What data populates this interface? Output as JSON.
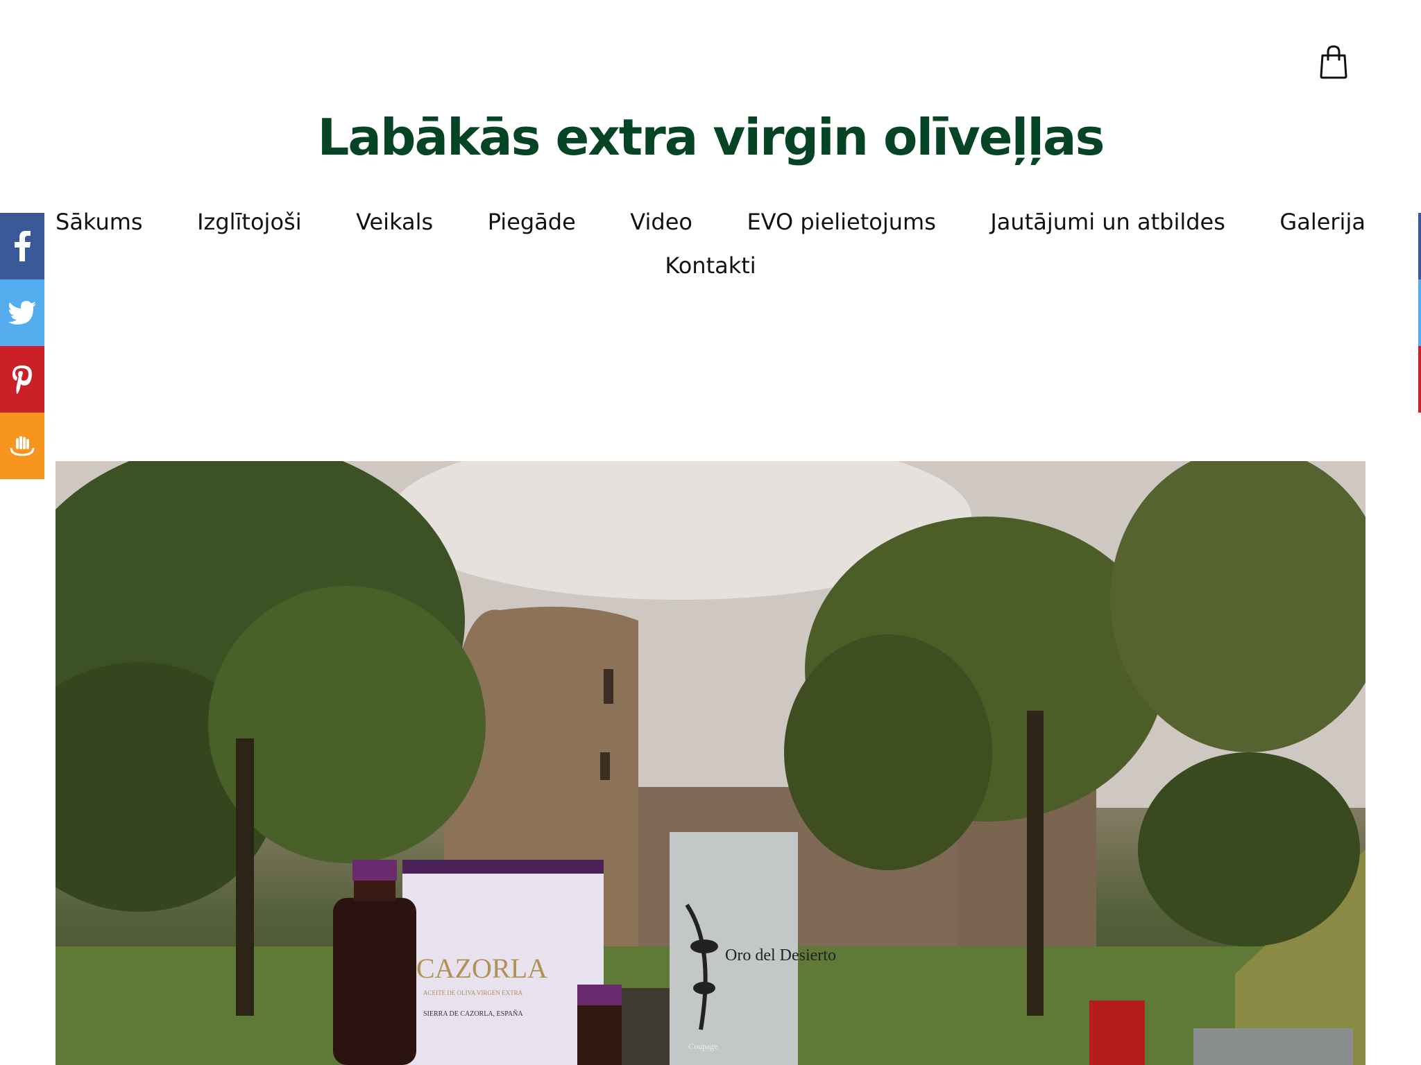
{
  "header": {
    "title": "Labākās extra virgin olīveļļas",
    "cart_icon": "shopping-bag-icon"
  },
  "nav": {
    "items": [
      "Sākums",
      "Izglītojoši",
      "Veikals",
      "Piegāde",
      "Video",
      "EVO pielietojums",
      "Jautājumi un atbildes",
      "Galerija",
      "Kontakti"
    ]
  },
  "share": {
    "buttons": [
      {
        "icon": "facebook-icon",
        "color": "#3b5998"
      },
      {
        "icon": "twitter-icon",
        "color": "#55acee"
      },
      {
        "icon": "pinterest-icon",
        "color": "#cb2027"
      },
      {
        "icon": "draugiem-icon",
        "color": "#f7941d"
      }
    ]
  },
  "hero": {
    "image_alt": "Olive oil products in front of a stone castle tower in a park",
    "can_brand_1": "CAZORLA",
    "can_brand_1_sub": "ACEITE DE OLIVA VIRGEN EXTRA",
    "can_brand_1_origin": "SIERRA DE CAZORLA, ESPAÑA",
    "can_brand_2": "Oro del Desierto",
    "can_brand_2_sub": "Coupage"
  },
  "colors": {
    "title_green": "#054425",
    "nav_text": "#111111"
  }
}
